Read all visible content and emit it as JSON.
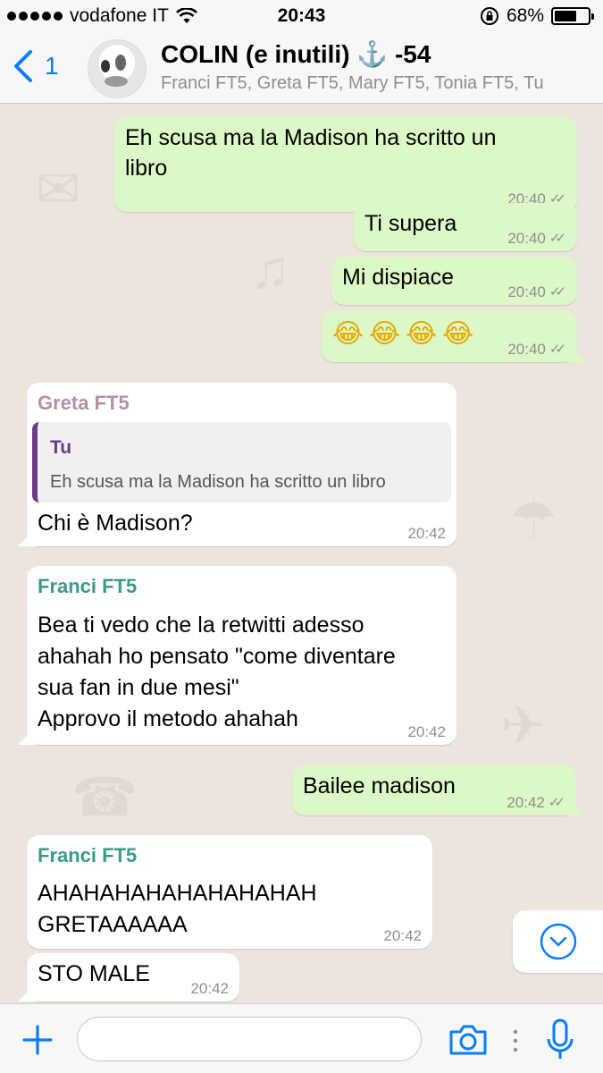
{
  "status_bar": {
    "carrier": "vodafone IT",
    "time": "20:43",
    "battery": "68%",
    "battery_level": 0.68
  },
  "header": {
    "back_count": "1",
    "group_name": "COLIN (e inutili) ⚓️ -54",
    "members": "Franci FT5, Greta FT5, Mary FT5, Tonia FT5, Tu"
  },
  "messages": [
    {
      "text1": "Eh scusa ma la Madison ha scritto un",
      "text2": "libro",
      "time": "20:40"
    },
    {
      "text": "Ti supera",
      "time": "20:40"
    },
    {
      "text": "Mi dispiace",
      "time": "20:40"
    },
    {
      "text": "😂😂😂😂",
      "time": "20:40"
    },
    {
      "sender": "Greta FT5",
      "quote_author": "Tu",
      "quote_text": "Eh scusa ma la Madison ha scritto un libro",
      "text": "Chi è Madison?",
      "time": "20:42"
    },
    {
      "sender": "Franci FT5",
      "line1": "Bea ti vedo che la retwitti adesso",
      "line2": "ahahah ho pensato \"come diventare",
      "line3": "sua fan in due mesi\"",
      "line4": "Approvo il metodo ahahah",
      "time": "20:42"
    },
    {
      "text": "Bailee madison",
      "time": "20:42"
    },
    {
      "sender": "Franci FT5",
      "line1": "AHAHAHAHAHAHAHAHAH",
      "line2": "GRETAAAAAA",
      "time": "20:42"
    },
    {
      "text": "STO MALE",
      "time": "20:42"
    }
  ],
  "input": {
    "placeholder": ""
  },
  "colors": {
    "accent": "#0a7cff",
    "outgoing_bubble": "#dcf8c6",
    "incoming_bubble": "#ffffff",
    "greta_name": "#b48fa7",
    "franci_name": "#3a9a8a",
    "quote_author": "#6a3a8a"
  },
  "icons": [
    "back-chevron-icon",
    "wifi-icon",
    "orientation-lock-icon",
    "battery-icon",
    "read-ticks-icon",
    "scroll-down-icon",
    "plus-icon",
    "camera-icon",
    "microphone-icon"
  ]
}
